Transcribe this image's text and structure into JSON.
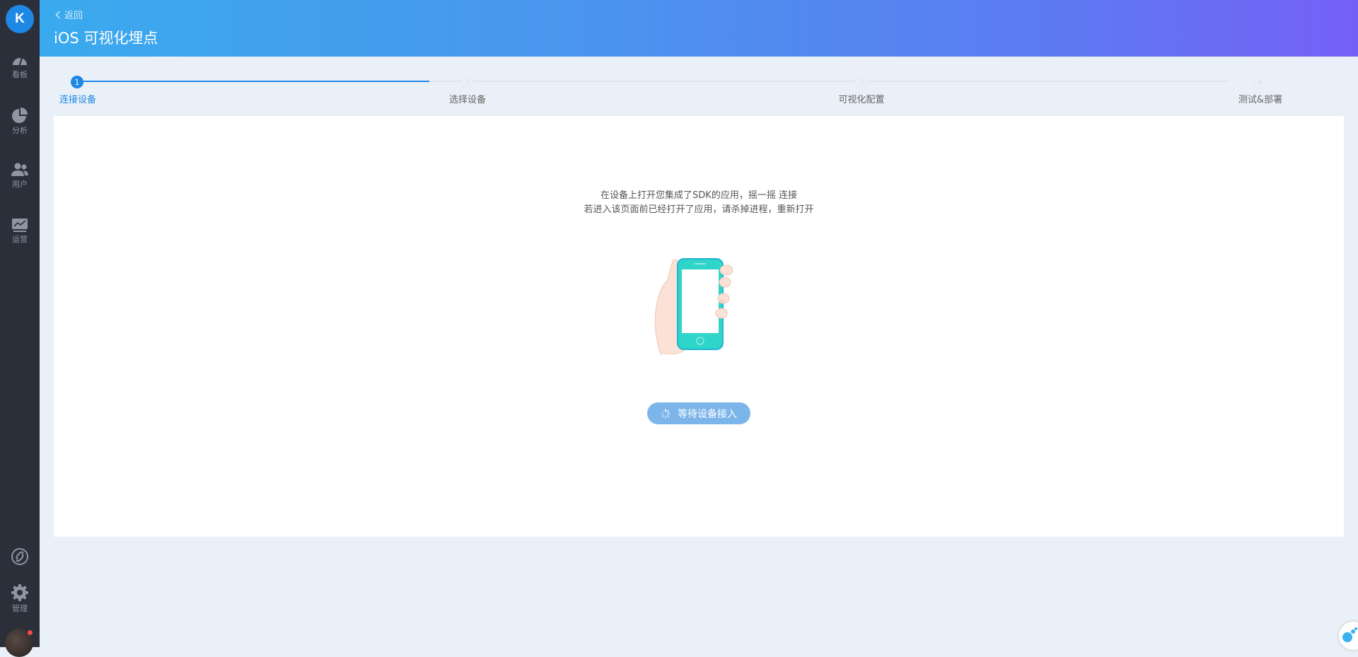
{
  "sidebar": {
    "logo": "K",
    "items": [
      {
        "label": "看板",
        "icon": "dashboard-icon"
      },
      {
        "label": "分析",
        "icon": "pie-chart-icon"
      },
      {
        "label": "用户",
        "icon": "users-icon"
      },
      {
        "label": "运营",
        "icon": "monitor-icon"
      }
    ],
    "bottom_items": [
      {
        "label": "",
        "icon": "link-icon"
      },
      {
        "label": "管理",
        "icon": "gear-icon"
      }
    ]
  },
  "header": {
    "back_label": "返回",
    "title": "iOS 可视化埋点"
  },
  "steps": [
    {
      "number": "1",
      "label": "连接设备",
      "state": "active"
    },
    {
      "number": "2",
      "label": "选择设备",
      "state": "pending"
    },
    {
      "number": "3",
      "label": "可视化配置",
      "state": "pending"
    },
    {
      "number": "4",
      "label": "测试&部署",
      "state": "pending"
    }
  ],
  "main": {
    "instruction_line1": "在设备上打开您集成了SDK的应用，摇一摇 连接",
    "instruction_line2": "若进入该页面前已经打开了应用，请杀掉进程，重新打开",
    "wait_button_label": "等待设备接入"
  },
  "colors": {
    "accent": "#1e88e5",
    "header_start": "#3aaaee",
    "header_end": "#7560f6",
    "sidebar_bg": "#2b2f3a",
    "button_bg": "#7cb5ea"
  }
}
